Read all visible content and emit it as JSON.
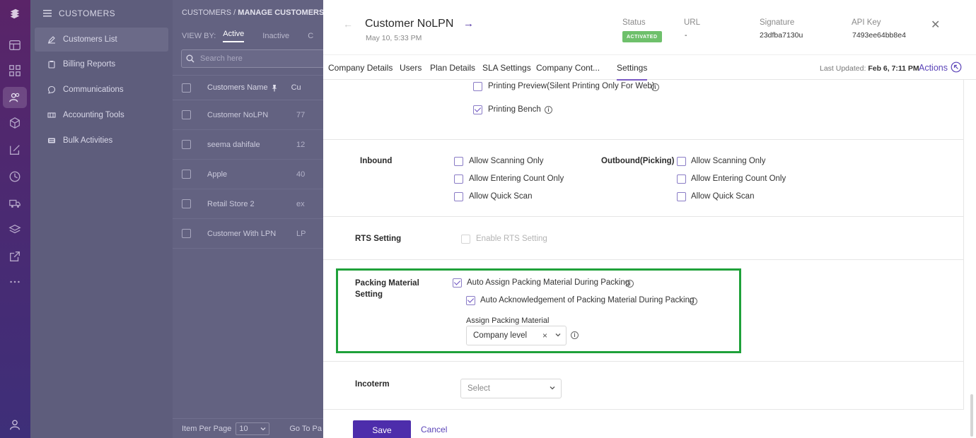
{
  "rail": {
    "icons": [
      "logo-icon",
      "layout-icon",
      "grid-icon",
      "users-icon",
      "box-icon",
      "edit-icon",
      "clock-icon",
      "truck-icon",
      "layers-icon",
      "external-link-icon",
      "more-icon",
      "profile-icon"
    ]
  },
  "nav": {
    "header": "CUSTOMERS",
    "items": [
      {
        "label": "Customers List",
        "icon": "pencil-icon",
        "active": true
      },
      {
        "label": "Billing Reports",
        "icon": "clipboard-icon"
      },
      {
        "label": "Communications",
        "icon": "chat-icon"
      },
      {
        "label": "Accounting Tools",
        "icon": "calculator-icon"
      },
      {
        "label": "Bulk Activities",
        "icon": "database-icon"
      }
    ]
  },
  "list": {
    "breadcrumb_root": "CUSTOMERS",
    "breadcrumb_sep": "/",
    "breadcrumb_current": "MANAGE CUSTOMERS",
    "view_by": "VIEW BY:",
    "tab_active": "Active",
    "tab_inactive": "Inactive",
    "tab_more": "C",
    "search_placeholder": "Search here",
    "col_name": "Customers Name",
    "col_code": "Cu",
    "rows": [
      {
        "name": "Customer NoLPN",
        "code": "77"
      },
      {
        "name": "seema dahifale",
        "code": "12"
      },
      {
        "name": "Apple",
        "code": "40"
      },
      {
        "name": "Retail Store 2",
        "code": "ex"
      },
      {
        "name": "Customer With LPN",
        "code": "LP"
      }
    ],
    "items_per_page_label": "Item Per Page",
    "items_per_page": "10",
    "goto_label": "Go To Pa"
  },
  "drawer": {
    "title": "Customer NoLPN",
    "date": "May 10, 5:33 PM",
    "status_label": "Status",
    "status_value": "ACTIVATED",
    "url_label": "URL",
    "url_value": "-",
    "signature_label": "Signature",
    "signature_value": "23dfba7130u",
    "apikey_label": "API Key",
    "apikey_value": "7493ee64bb8e4",
    "tabs": [
      "Company Details",
      "Users",
      "Plan Details",
      "SLA Settings",
      "Company Cont...",
      "Settings"
    ],
    "last_updated_label": "Last Updated:",
    "last_updated_value": "Feb 6, 7:11 PM",
    "actions_label": "Actions",
    "printing_preview_label": "Printing Preview(Silent Printing Only For Web)",
    "printing_bench_label": "Printing Bench",
    "inbound_title": "Inbound",
    "outbound_title": "Outbound(Picking)",
    "allow_scanning_only": "Allow Scanning Only",
    "allow_entering_count_only": "Allow Entering Count Only",
    "allow_quick_scan": "Allow Quick Scan",
    "rts_title": "RTS Setting",
    "rts_enable_label": "Enable RTS Setting",
    "packing_title_line1": "Packing Material",
    "packing_title_line2": "Setting",
    "auto_assign_label": "Auto Assign Packing Material During Packing",
    "auto_ack_label": "Auto Acknowledgement of Packing Material During Packing",
    "assign_packing_label": "Assign Packing Material",
    "assign_packing_value": "Company level",
    "incoterm_title": "Incoterm",
    "incoterm_placeholder": "Select",
    "save_label": "Save",
    "cancel_label": "Cancel"
  },
  "colors": {
    "accent": "#4d2dab",
    "status_green": "#6ec06b",
    "highlight_green": "#1fa13a"
  }
}
